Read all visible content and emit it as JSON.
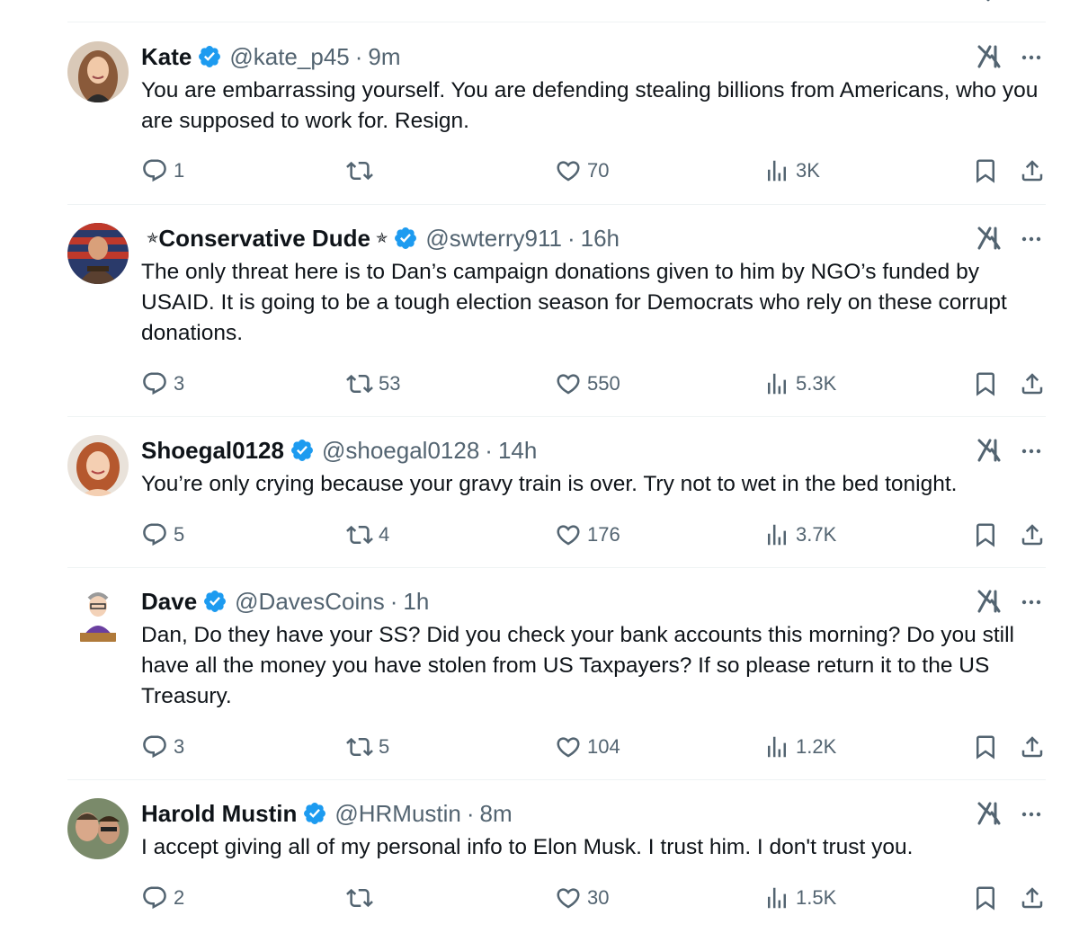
{
  "accent": "#1d9bf0",
  "muted": "#536471",
  "tweets": [
    {
      "name": "Kate",
      "handle": "@kate_p45",
      "time": "9m",
      "verified": true,
      "stars": false,
      "text": "You are embarrassing yourself. You are defending stealing billions from Americans, who you are supposed to work for. Resign.",
      "replies": "1",
      "reposts": "",
      "likes": "70",
      "views": "3K",
      "avatar_icon": "woman-portrait"
    },
    {
      "name": "Conservative Dude",
      "handle": "@swterry911",
      "time": "16h",
      "verified": true,
      "stars": true,
      "star_glyph": "✯",
      "text": "The only threat here is to Dan’s campaign donations given to him by NGO’s funded by USAID. It is going to be a tough election season for Democrats who rely on these corrupt donations.",
      "replies": "3",
      "reposts": "53",
      "likes": "550",
      "views": "5.3K",
      "avatar_icon": "soldier-flag-portrait"
    },
    {
      "name": "Shoegal0128",
      "handle": "@shoegal0128",
      "time": "14h",
      "verified": true,
      "stars": false,
      "text": "You’re only crying because your gravy train is over. Try not to wet in the bed tonight.",
      "replies": "5",
      "reposts": "4",
      "likes": "176",
      "views": "3.7K",
      "avatar_icon": "redhead-portrait"
    },
    {
      "name": "Dave",
      "handle": "@DavesCoins",
      "time": "1h",
      "verified": true,
      "stars": false,
      "text": "Dan, Do they have your SS? Did you check your bank accounts this morning? Do you still have all the money you have stolen from US Taxpayers? If so please return it to the US Treasury.",
      "replies": "3",
      "reposts": "5",
      "likes": "104",
      "views": "1.2K",
      "avatar_icon": "cartoon-man-portrait"
    },
    {
      "name": "Harold Mustin",
      "handle": "@HRMustin",
      "time": "8m",
      "verified": true,
      "stars": false,
      "text": "I accept giving all of my personal info to Elon Musk. I trust him. I don't trust you.",
      "replies": "2",
      "reposts": "",
      "likes": "30",
      "views": "1.5K",
      "avatar_icon": "two-men-portrait"
    }
  ]
}
